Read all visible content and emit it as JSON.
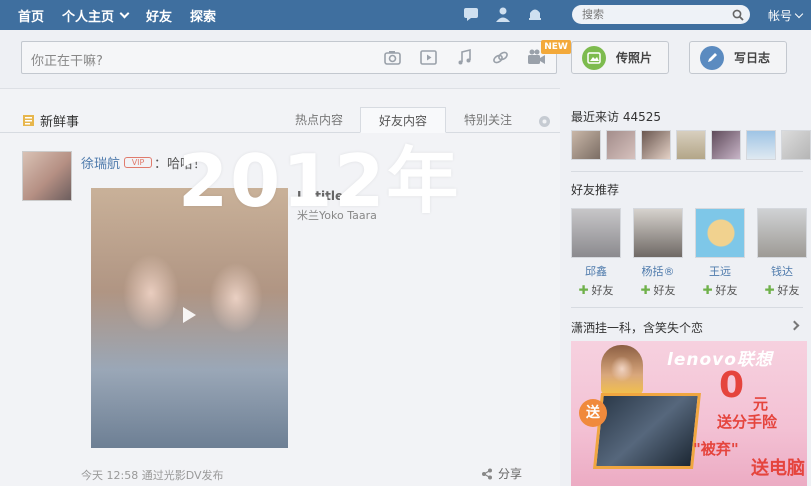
{
  "nav": {
    "items": [
      "首页",
      "个人主页",
      "好友",
      "探索"
    ],
    "search_placeholder": "搜索",
    "account_label": "帐号"
  },
  "status": {
    "placeholder": "你正在干嘛?",
    "new_badge": "NEW",
    "photo_button": "传照片",
    "blog_button": "写日志"
  },
  "feed": {
    "title": "新鲜事",
    "tabs": [
      "热点内容",
      "好友内容",
      "特别关注"
    ],
    "active_tab": "好友内容",
    "post": {
      "author": "徐瑞航",
      "vip_badge": "VIP",
      "text": "：哈哈！",
      "music_title": "Untitled",
      "music_sub": "米兰Yoko Taara",
      "meta": "今天 12:58  通过光影DV发布",
      "share_label": "分享"
    }
  },
  "overlay_title": "2012年",
  "sidebar": {
    "recent_label": "最近来访 44525",
    "recommend_label": "好友推荐",
    "recommendations": [
      {
        "name": "邱鑫",
        "add": "好友"
      },
      {
        "name": "杨括®",
        "add": "好友"
      },
      {
        "name": "王远",
        "add": "好友"
      },
      {
        "name": "钱达",
        "add": "好友"
      }
    ],
    "ad_label": "潇洒挂一科，含笑失个恋",
    "ad": {
      "brand": "lenovo联想",
      "zero": "0",
      "yuan": "元",
      "slogan1": "送分手险",
      "slogan2": "\"被弃\"",
      "slogan3": "送电脑",
      "badge": "送"
    }
  },
  "colors": {
    "nav_bg": "#3f6f9f",
    "link_blue": "#4f7bac",
    "accent_red": "#e5443d",
    "add_green": "#6fb14a"
  }
}
